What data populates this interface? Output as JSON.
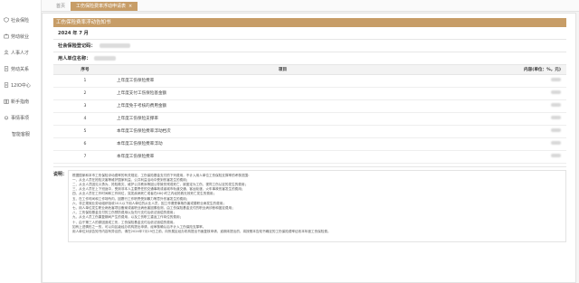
{
  "sidebar": {
    "items": [
      {
        "label": "社会保险",
        "icon": "shield-icon"
      },
      {
        "label": "劳动就业",
        "icon": "briefcase-icon"
      },
      {
        "label": "人事人才",
        "icon": "person-icon"
      },
      {
        "label": "劳动关系",
        "icon": "document-icon"
      },
      {
        "label": "12IO中心",
        "icon": "document-icon"
      },
      {
        "label": "新手指南",
        "icon": "book-icon"
      },
      {
        "label": "事情事项",
        "icon": "bell-icon"
      },
      {
        "label": "智能客服",
        "icon": ""
      }
    ]
  },
  "tabs": {
    "home": "首页",
    "active": "工伤保险费率浮动申请表",
    "close": "×"
  },
  "panel": {
    "title": "工伤保险费率浮动告知书",
    "date": "2024 年 7 月",
    "reg_no_label": "社会保险登记码：",
    "unit_name_label": "用人单位名称："
  },
  "table": {
    "headers": {
      "no": "序号",
      "item": "项目",
      "amount": "内容(单位：%，元)"
    },
    "rows": [
      {
        "no": "1",
        "item": "上年度工伤保险费率"
      },
      {
        "no": "2",
        "item": "上年度支付工伤保险基金额"
      },
      {
        "no": "3",
        "item": "上年度免于考核的费用金额"
      },
      {
        "no": "4",
        "item": "上年度工伤保险支撑率"
      },
      {
        "no": "5",
        "item": "本年度工伤保险费率浮动档次"
      },
      {
        "no": "6",
        "item": "本年度工伤保险费率浮动"
      },
      {
        "no": "7",
        "item": "本年度工伤保险费率"
      }
    ]
  },
  "note": {
    "label": "说明：",
    "lines": [
      "根据国家和本市工伤保险浮动费率的有关规定，工伤保险基金支付的下列费用，不计入用人单位工伤保险支撑率的考核范围：",
      "一、从业人员在抢险灾害等维护国家利益、公共利益活动中受到伤害发生的费用；",
      "二、从业人员因见义勇为、抢险救灾、维护公共秩序等因公导致伤残或死亡，被鉴定为工伤、视同工伤认定的发生的费用；",
      "三、从业人员在上下班途中，受到非本人主要责任的交通事故或者城市轨道交通、客运轮渡、火车事故伤害发生的费用；",
      "四、从业人员在工作时间和工作岗位，突发疾病死亡或者在48小时之内经抢救无效死亡发生的费用；",
      "五、在工作时间和工作场所内，因履行工作职责受到暴力等意外伤害发生的费用；",
      "六、非正规就业劳动组织吸收10人以下用人单位的从业人员，因工作遭受事故伤害或患职业病发生的费用；",
      "七、用人单位发生职业病危害项目备案或者职业病危害因素检测，由工伤保险基金支付的职业病诊断和鉴定费用；",
      "八、工伤保险基金支付的工伤预防费用以及先行支付后依法追偿的费用；",
      "九、从业人员工伤康复期间产生的费用，以及工伤职工重返工作岗位的费用；",
      "十、由于第三人的原因造成工伤，工伤保险基金支付后依法追偿的费用。",
      "如有上述情形之一的，可以向区级经办机构提出申请，经审核确认后不计入工伤保险支撑率。",
      "用人单位对该告知书内容有异议的，请在2024年7月19日之前，向所属区经办机构提出书面复核申请，逾期未提出的，将按照本告知书确定的工伤保险费率征收本年度工伤保险费。"
    ]
  },
  "colors": {
    "accent": "#c79d67"
  }
}
